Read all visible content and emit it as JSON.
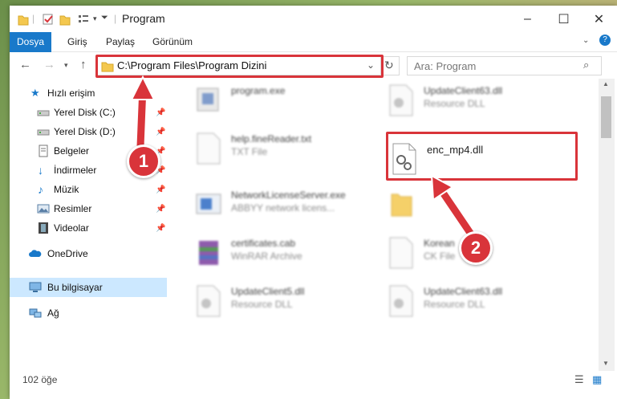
{
  "window": {
    "title": "Program"
  },
  "ribbon": {
    "tabs": [
      "Dosya",
      "Giriş",
      "Paylaş",
      "Görünüm"
    ]
  },
  "address": {
    "path": "C:\\Program Files\\Program Dizini"
  },
  "search": {
    "placeholder": "Ara: Program"
  },
  "sidebar": {
    "items": [
      {
        "label": "Hızlı erişim"
      },
      {
        "label": "Yerel Disk (C:)"
      },
      {
        "label": "Yerel Disk (D:)"
      },
      {
        "label": "Belgeler"
      },
      {
        "label": "İndirmeler"
      },
      {
        "label": "Müzik"
      },
      {
        "label": "Resimler"
      },
      {
        "label": "Videolar"
      },
      {
        "label": "OneDrive"
      },
      {
        "label": "Bu bilgisayar"
      },
      {
        "label": "Ağ"
      }
    ]
  },
  "files": [
    {
      "name": "program.exe",
      "desc": ""
    },
    {
      "name": "UpdateClient63.dll",
      "desc": "Resource DLL"
    },
    {
      "name": "help.fineReader.txt",
      "desc": "TXT File"
    },
    {
      "name": "enc_mp4.dll",
      "desc": ""
    },
    {
      "name": "NetworkLicenseServer.exe",
      "desc": "ABBYY network licens..."
    },
    {
      "name": "certificates.cab",
      "desc": "WinRAR Archive"
    },
    {
      "name": "Korean",
      "desc": "CK File"
    },
    {
      "name": "UpdateClient5.dll",
      "desc": "Resource DLL"
    },
    {
      "name": "UpdateClient63.dll",
      "desc": "Resource DLL"
    }
  ],
  "status": {
    "count": "102 öğe"
  },
  "annotations": {
    "step1": "1",
    "step2": "2"
  },
  "colors": {
    "accent": "#1979ca",
    "highlight": "#d9343a",
    "selected": "#cce8ff"
  }
}
